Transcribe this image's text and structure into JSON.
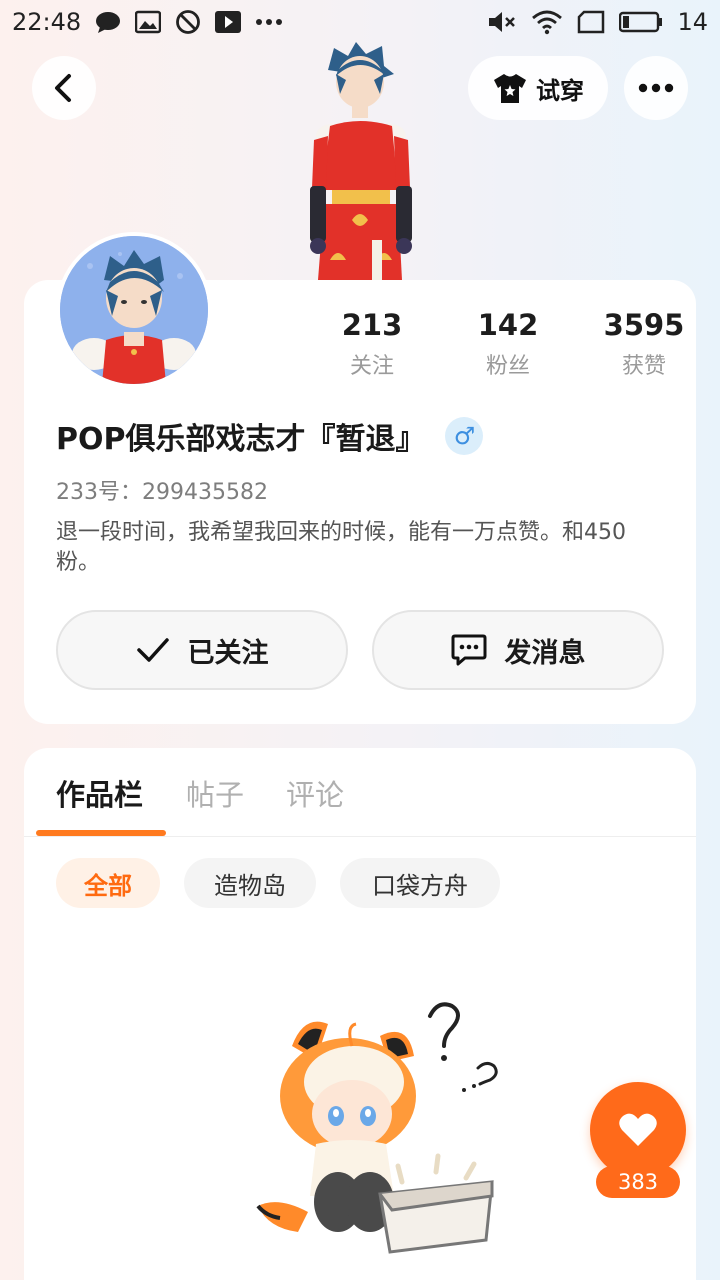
{
  "status_bar": {
    "time": "22:48",
    "battery": "14",
    "icons": [
      "message-icon",
      "image-icon",
      "blocked-icon",
      "play-icon",
      "more-dots-icon",
      "mute-icon",
      "wifi-icon",
      "screen-icon",
      "battery-icon"
    ]
  },
  "header": {
    "back_icon": "chevron-left-icon",
    "tryon_label": "试穿",
    "tryon_icon": "tshirt-icon",
    "more_icon": "more-dots-icon"
  },
  "profile": {
    "stats": [
      {
        "value": "213",
        "label": "关注"
      },
      {
        "value": "142",
        "label": "粉丝"
      },
      {
        "value": "3595",
        "label": "获赞"
      }
    ],
    "name": "POP俱乐部戏志才『暂退』",
    "gender_symbol": "♂",
    "uid": "233号：299435582",
    "bio": "退一段时间，我希望我回来的时候，能有一万点赞。和450粉。",
    "follow_label": "已关注",
    "message_label": "发消息"
  },
  "works": {
    "tabs": [
      "作品栏",
      "帖子",
      "评论"
    ],
    "active_tab": 0,
    "filters": [
      "全部",
      "造物岛",
      "口袋方舟"
    ],
    "active_filter": 0
  },
  "like": {
    "count": "383"
  },
  "colors": {
    "accent": "#ff6a1a",
    "tab_underline": "#ff7a1f",
    "gender_blue": "#3d8fe0"
  }
}
